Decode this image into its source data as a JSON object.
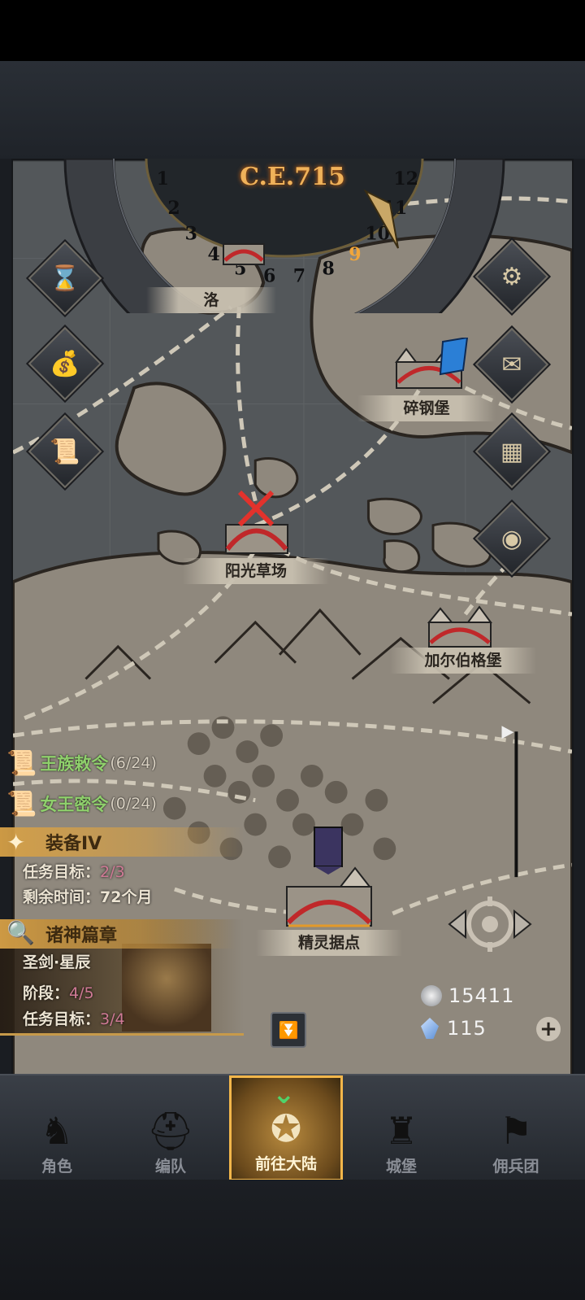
{
  "header": {
    "era": "C.E.715",
    "months": [
      "1",
      "2",
      "3",
      "4",
      "5",
      "6",
      "7",
      "8",
      "9",
      "10",
      "11",
      "12"
    ],
    "current_month": "9"
  },
  "side_buttons_left": [
    {
      "icon": "hourglass-icon"
    },
    {
      "icon": "money-bag-icon"
    },
    {
      "icon": "scroll-icon"
    }
  ],
  "side_buttons_right": [
    {
      "icon": "gear-icon"
    },
    {
      "icon": "mail-icon"
    },
    {
      "icon": "map-grid-icon"
    },
    {
      "icon": "coin-icon"
    }
  ],
  "places": {
    "partial_top": "洛",
    "steel_castle": "碎钢堡",
    "sunshine_meadow": "阳光草场",
    "garberg_castle": "加尔伯格堡",
    "elf_outpost": "精灵据点"
  },
  "quests": {
    "royal_decree": {
      "label": "王族敕令",
      "count": "(6/24)"
    },
    "queen_secret": {
      "label": "女王密令",
      "count": "(0/24)"
    }
  },
  "equipment_task": {
    "title": "装备IV",
    "goal_label": "任务目标：",
    "goal_value": "2/3",
    "time_label": "剩余时间：",
    "time_value": "72个月"
  },
  "chapter_task": {
    "title": "诸神篇章",
    "subtitle": "圣剑·星辰",
    "stage_label": "阶段：",
    "stage_value": "4/5",
    "goal_label": "任务目标：",
    "goal_value": "3/4"
  },
  "currency": {
    "silver": "15411",
    "crystal": "115"
  },
  "nav": [
    {
      "label": "角色",
      "icon": "knight-icon"
    },
    {
      "label": "编队",
      "icon": "helmet-icon"
    },
    {
      "label": "前往大陆",
      "icon": "globe-icon",
      "active": true
    },
    {
      "label": "城堡",
      "icon": "castle-icon"
    },
    {
      "label": "佣兵团",
      "icon": "banner-icon"
    }
  ],
  "colors": {
    "accent_gold": "#f2b64a",
    "quest_green": "#8fd06c",
    "progress_pink": "#d07a96",
    "map_parchment": "#8f887d"
  }
}
